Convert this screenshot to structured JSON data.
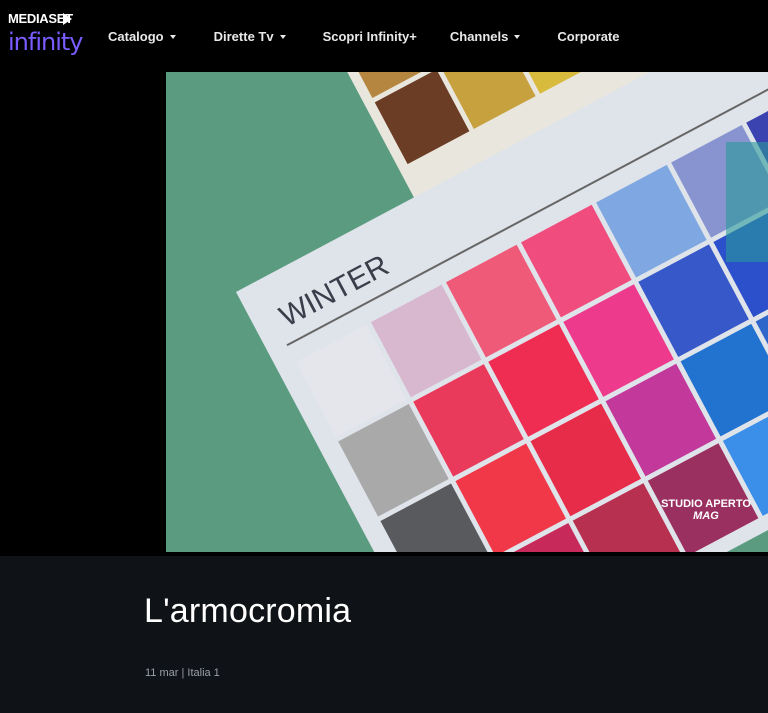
{
  "logo": {
    "top": "MEDIASET",
    "bottom": "infinity"
  },
  "nav": [
    {
      "label": "Catalogo",
      "dropdown": true
    },
    {
      "label": "Dirette Tv",
      "dropdown": true
    },
    {
      "label": "Scopri Infinity+",
      "dropdown": false
    },
    {
      "label": "Channels",
      "dropdown": true
    },
    {
      "label": "Corporate",
      "dropdown": false
    }
  ],
  "video": {
    "card_label": "WINTER",
    "watermark_line1": "STUDIO APERTO",
    "watermark_line2": "MAG"
  },
  "content": {
    "title": "L'armocromia",
    "meta": "11 mar | Italia 1"
  },
  "colors": {
    "background": "#000000",
    "info_bg": "#0f1217",
    "brand": "#7b5cff"
  }
}
